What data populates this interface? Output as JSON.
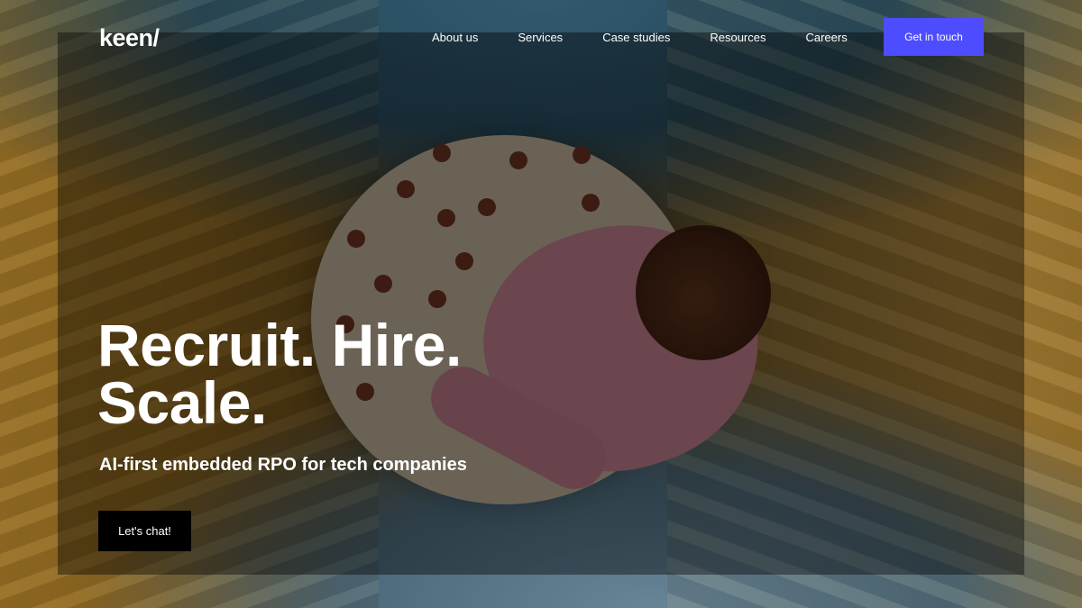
{
  "header": {
    "logo": "keen/",
    "nav": [
      "About us",
      "Services",
      "Case studies",
      "Resources",
      "Careers"
    ],
    "cta": "Get in touch"
  },
  "hero": {
    "headline_line1": "Recruit. Hire.",
    "headline_line2": "Scale.",
    "subheadline": "AI-first embedded RPO for tech companies",
    "cta": "Let's chat!"
  },
  "colors": {
    "accent": "#4d4dff",
    "cta_dark": "#000000",
    "text": "#ffffff"
  }
}
